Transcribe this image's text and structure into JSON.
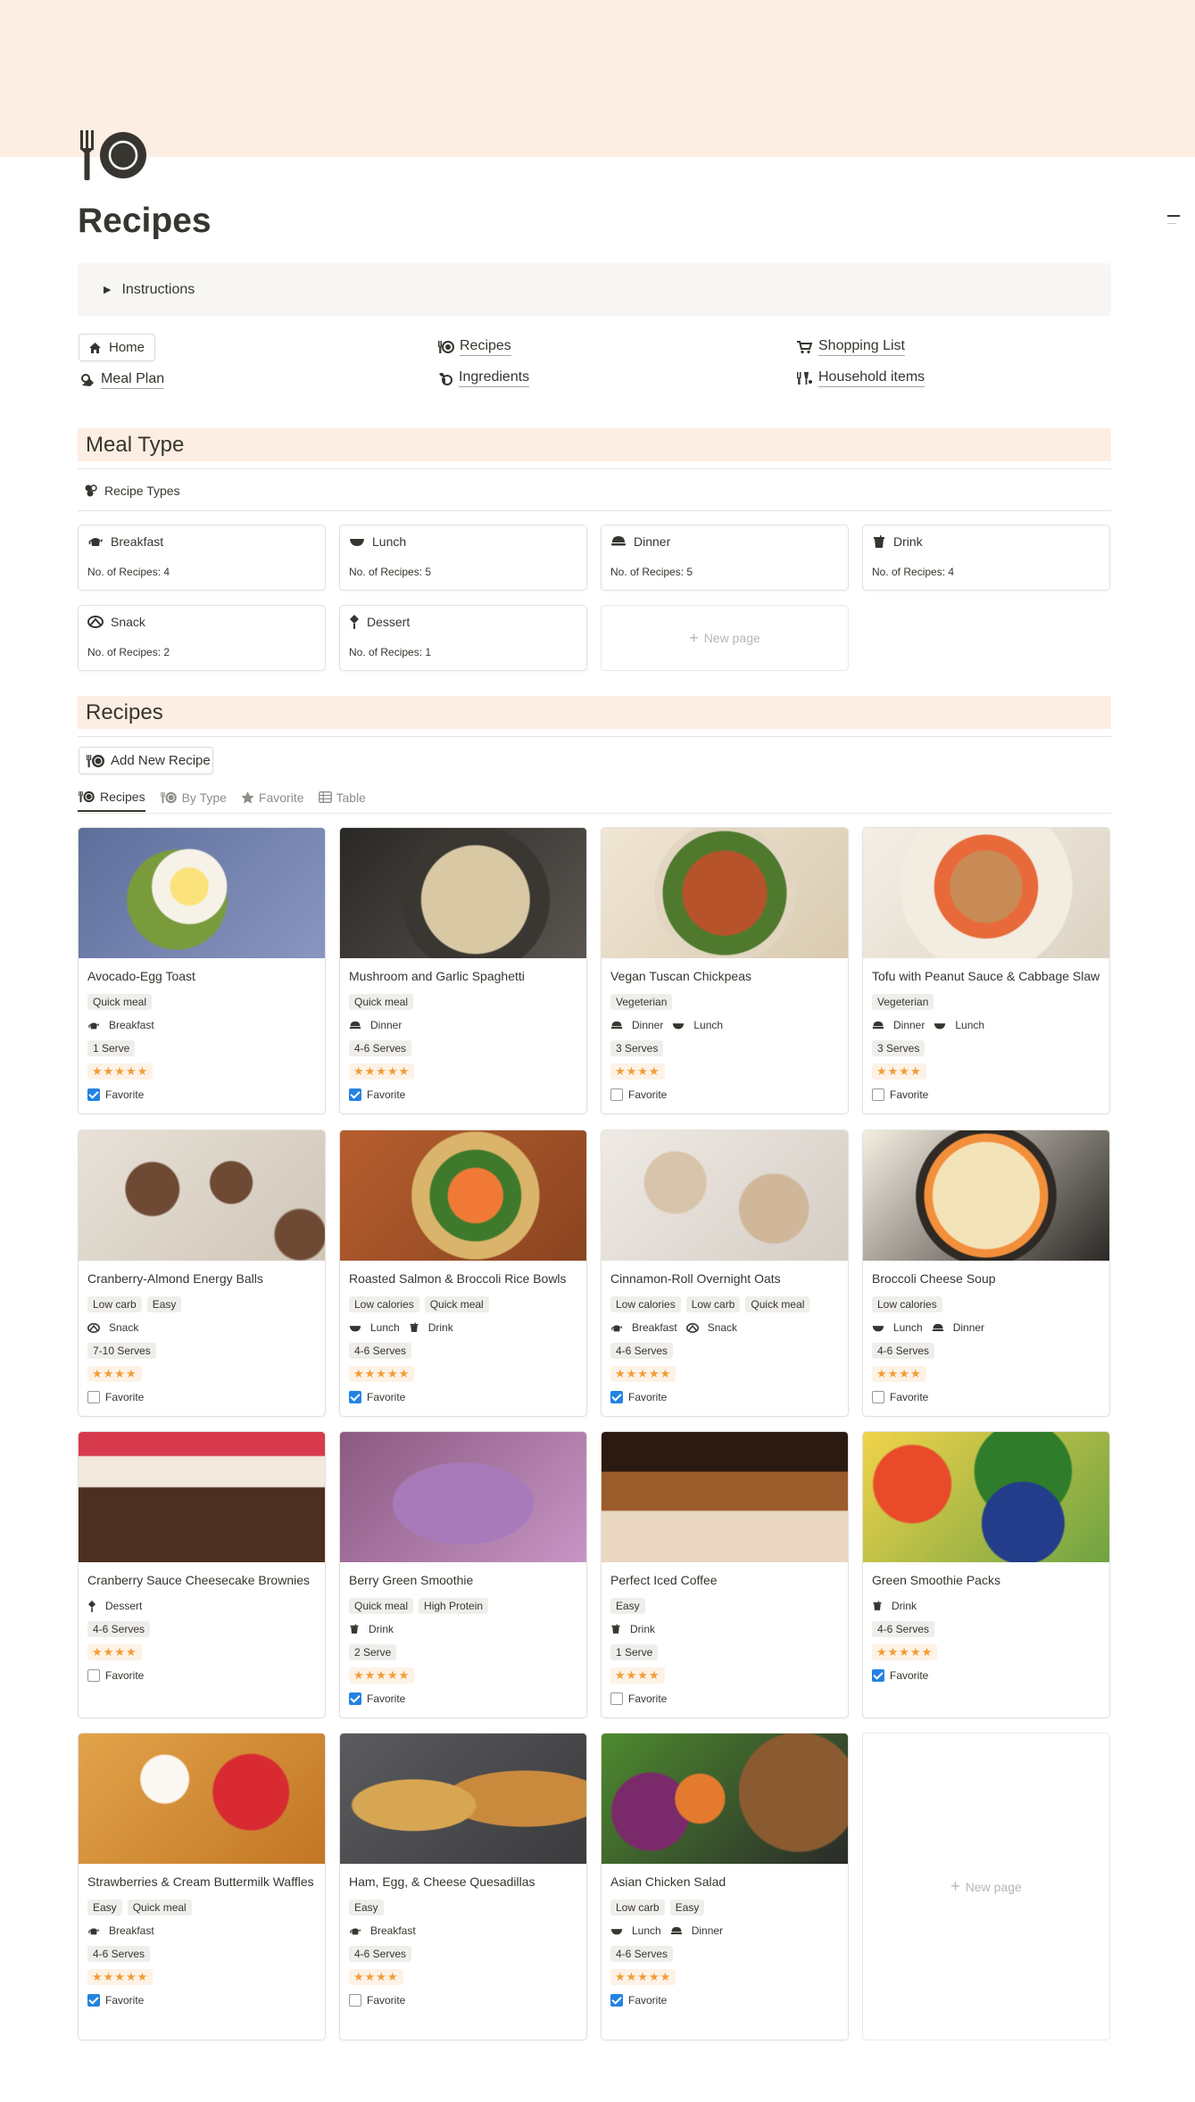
{
  "page": {
    "title": "Recipes"
  },
  "callout": {
    "label": "Instructions"
  },
  "nav": {
    "home": "Home",
    "meal_plan": "Meal Plan",
    "recipes": "Recipes",
    "ingredients": "Ingredients",
    "shopping_list": "Shopping List",
    "household_items": "Household items"
  },
  "sections": {
    "meal_type": "Meal Type",
    "recipes": "Recipes"
  },
  "recipe_types_db": {
    "title": "Recipe Types",
    "cards": [
      {
        "name": "Breakfast",
        "count": "No. of Recipes: 4",
        "icon": "teapot-icon"
      },
      {
        "name": "Lunch",
        "count": "No. of Recipes: 5",
        "icon": "bowl-icon"
      },
      {
        "name": "Dinner",
        "count": "No. of Recipes: 5",
        "icon": "covered-dish-icon"
      },
      {
        "name": "Drink",
        "count": "No. of Recipes: 4",
        "icon": "cup-icon"
      },
      {
        "name": "Snack",
        "count": "No. of Recipes: 2",
        "icon": "pretzel-icon"
      },
      {
        "name": "Dessert",
        "count": "No. of Recipes: 1",
        "icon": "popsicle-icon"
      }
    ],
    "new_page": "New page"
  },
  "recipes_db": {
    "add_button": "Add New Recipe",
    "tabs": [
      "Recipes",
      "By Type",
      "Favorite",
      "Table"
    ],
    "favorite_label": "Favorite",
    "new_page": "New page",
    "cards": [
      {
        "name": "Avocado-Egg Toast",
        "tags": [
          "Quick meal"
        ],
        "meals": [
          "Breakfast"
        ],
        "serves": "1 Serve",
        "stars": "★★★★★",
        "favorite": true
      },
      {
        "name": "Mushroom and Garlic Spaghetti",
        "tags": [
          "Quick meal"
        ],
        "meals": [
          "Dinner"
        ],
        "serves": "4-6 Serves",
        "stars": "★★★★★",
        "favorite": true
      },
      {
        "name": "Vegan Tuscan Chickpeas",
        "tags": [
          "Vegeterian"
        ],
        "meals": [
          "Dinner",
          "Lunch"
        ],
        "serves": "3 Serves",
        "stars": "★★★★",
        "favorite": false
      },
      {
        "name": "Tofu with Peanut Sauce & Cabbage Slaw",
        "tags": [
          "Vegeterian"
        ],
        "meals": [
          "Dinner",
          "Lunch"
        ],
        "serves": "3 Serves",
        "stars": "★★★★",
        "favorite": false
      },
      {
        "name": "Cranberry-Almond Energy Balls",
        "tags": [
          "Low carb",
          "Easy"
        ],
        "meals": [
          "Snack"
        ],
        "serves": "7-10 Serves",
        "stars": "★★★★",
        "favorite": false
      },
      {
        "name": "Roasted Salmon & Broccoli Rice Bowls",
        "tags": [
          "Low calories",
          "Quick meal"
        ],
        "meals": [
          "Lunch",
          "Drink"
        ],
        "serves": "4-6 Serves",
        "stars": "★★★★★",
        "favorite": true
      },
      {
        "name": "Cinnamon-Roll Overnight Oats",
        "tags": [
          "Low calories",
          "Low carb",
          "Quick meal"
        ],
        "meals": [
          "Breakfast",
          "Snack"
        ],
        "serves": "4-6 Serves",
        "stars": "★★★★★",
        "favorite": true
      },
      {
        "name": "Broccoli Cheese Soup",
        "tags": [
          "Low calories"
        ],
        "meals": [
          "Lunch",
          "Dinner"
        ],
        "serves": "4-6 Serves",
        "stars": "★★★★",
        "favorite": false
      },
      {
        "name": "Cranberry Sauce Cheesecake Brownies",
        "tags": [],
        "meals": [
          "Dessert"
        ],
        "serves": "4-6 Serves",
        "stars": "★★★★",
        "favorite": false
      },
      {
        "name": "Berry Green Smoothie",
        "tags": [
          "Quick meal",
          "High Protein"
        ],
        "meals": [
          "Drink"
        ],
        "serves": "2 Serve",
        "stars": "★★★★★",
        "favorite": true
      },
      {
        "name": "Perfect Iced Coffee",
        "tags": [
          "Easy"
        ],
        "meals": [
          "Drink"
        ],
        "serves": "1 Serve",
        "stars": "★★★★",
        "favorite": false
      },
      {
        "name": "Green Smoothie Packs",
        "tags": [],
        "meals": [
          "Drink"
        ],
        "serves": "4-6 Serves",
        "stars": "★★★★★",
        "favorite": true
      },
      {
        "name": "Strawberries & Cream Buttermilk Waffles",
        "tags": [
          "Easy",
          "Quick meal"
        ],
        "meals": [
          "Breakfast"
        ],
        "serves": "4-6 Serves",
        "stars": "★★★★★",
        "favorite": true
      },
      {
        "name": "Ham, Egg, & Cheese Quesadillas",
        "tags": [
          "Easy"
        ],
        "meals": [
          "Breakfast"
        ],
        "serves": "4-6 Serves",
        "stars": "★★★★",
        "favorite": false
      },
      {
        "name": "Asian Chicken Salad",
        "tags": [
          "Low carb",
          "Easy"
        ],
        "meals": [
          "Lunch",
          "Dinner"
        ],
        "serves": "4-6 Serves",
        "stars": "★★★★★",
        "favorite": true
      }
    ]
  },
  "colors": {
    "cover": "#fdeee3",
    "section_bg": "#fdeee3",
    "star": "#f39c35",
    "checkbox": "#2383e2"
  }
}
